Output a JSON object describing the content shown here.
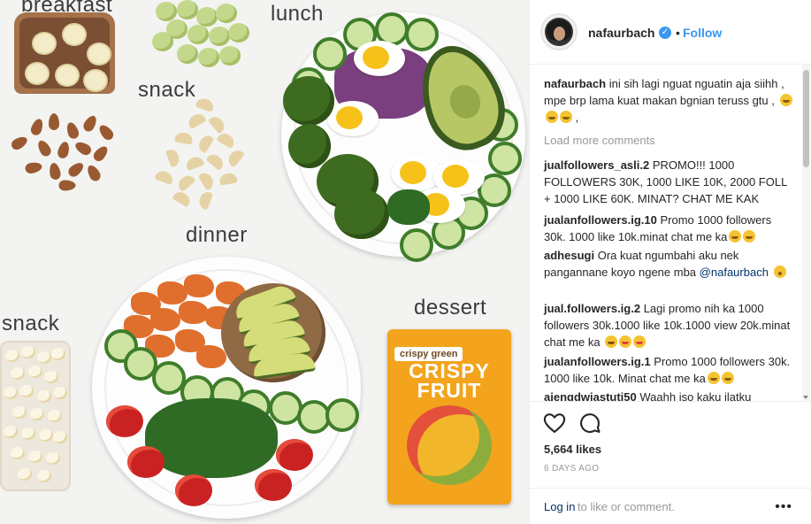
{
  "photo": {
    "labels": {
      "breakfast": "breakfast",
      "snack_top": "snack",
      "lunch": "lunch",
      "dinner": "dinner",
      "snack_left": "snack",
      "dessert": "dessert"
    },
    "package": {
      "brand": "crispy green",
      "title_line1": "CRISPY",
      "title_line2": "FRUIT"
    }
  },
  "post": {
    "username": "nafaurbach",
    "verified_icon": "verified-badge-icon",
    "dot": "•",
    "follow_label": "Follow"
  },
  "comments": {
    "caption_user": "nafaurbach",
    "caption_text": "ini sih lagi nguat nguatin aja siihh , mpe brp lama kuat makan bgnian teruss gtu ,",
    "load_more": "Load more comments",
    "items": [
      {
        "user": "jualfollowers_asli.2",
        "text": "PROMO!!! 1000 FOLLOWERS 30K, 1000 LIKE 10K, 2000 FOLL + 1000 LIKE 60K. MINAT? CHAT ME KAK"
      },
      {
        "user": "jualanfollowers.ig.10",
        "text": "Promo 1000 followers 30k. 1000 like 10k.minat chat me ka"
      },
      {
        "user": "adhesugi",
        "text": "Ora kuat ngumbahi aku nek pangannane koyo ngene mba",
        "mention": "@nafaurbach"
      },
      {
        "user": "jual.followers.ig.2",
        "text": "Lagi promo nih ka 1000 followers 30k.1000 like 10k.1000 view 20k.minat chat me ka"
      },
      {
        "user": "jualanfollowers.ig.1",
        "text": "Promo 1000 followers 30k. 1000 like 10k. Minat chat me ka"
      },
      {
        "user": "aiengdwiastuti50",
        "text": "Waahh iso kaku ilatku"
      }
    ]
  },
  "actions": {
    "like_icon": "heart-icon",
    "comment_icon": "comment-icon",
    "likes": "5,664 likes",
    "timestamp": "6 DAYS AGO",
    "login_link": "Log in",
    "login_rest": "to like or comment.",
    "more": "•••"
  },
  "colors": {
    "accent": "#3897f0",
    "link": "#003569",
    "muted": "#999999"
  }
}
